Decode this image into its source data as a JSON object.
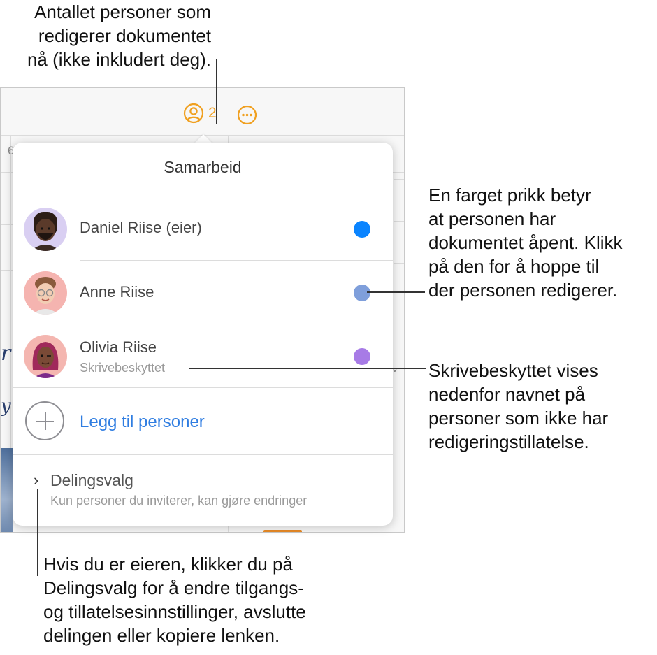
{
  "callouts": {
    "top": "Antallet personer som\nredigerer dokumentet\nnå (ikke inkludert deg).",
    "dot": "En farget prikk betyr\nat personen har\ndokumentet åpent. Klikk\npå den for å hoppe til\nder personen redigerer.",
    "readonly": "Skrivebeskyttet vises\nnedenfor navnet på\npersoner som ikke har\nredigeringstillatelse.",
    "sharing": "Hvis du er eieren, klikker du på\nDelingsvalg for å endre tilgangs-\nog tillatelsesinnstillinger, avslutte\ndelingen eller kopiere lenken."
  },
  "toolbar": {
    "collab_icon": "person-circle-icon",
    "collab_count": "2",
    "more_icon": "ellipsis-circle-icon",
    "accent": "#f0a020"
  },
  "app": {
    "ruler_label": "6"
  },
  "popover": {
    "title": "Samarbeid",
    "people": [
      {
        "name": "Daniel Riise (eier)",
        "status": "",
        "dot_color": "#0a84ff",
        "avatar": "memoji-daniel"
      },
      {
        "name": "Anne Riise",
        "status": "",
        "dot_color": "#7f9fdb",
        "avatar": "memoji-anne"
      },
      {
        "name": "Olivia Riise",
        "status": "Skrivebeskyttet",
        "dot_color": "#a77be6",
        "avatar": "memoji-olivia"
      }
    ],
    "add_label": "Legg til personer",
    "sharing_title": "Delingsvalg",
    "sharing_subtitle": "Kun personer du inviterer, kan gjøre endringer"
  }
}
